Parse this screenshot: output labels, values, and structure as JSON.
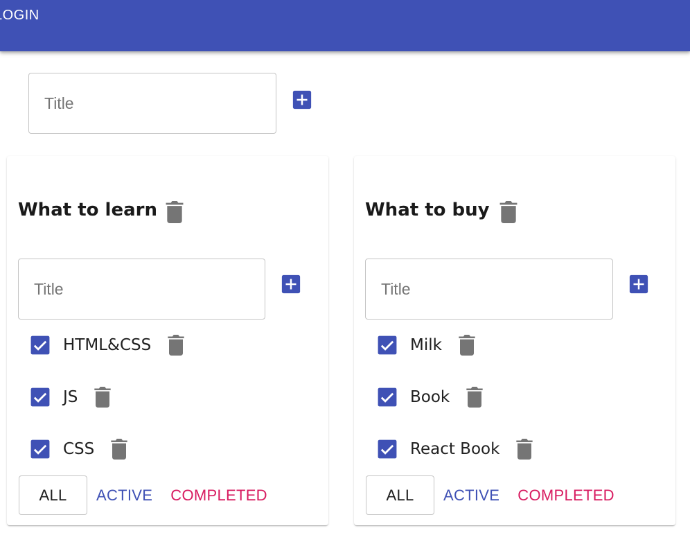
{
  "appbar": {
    "login_label": "LOGIN"
  },
  "add_list": {
    "placeholder": "Title"
  },
  "colors": {
    "primary": "#3f51b5",
    "secondary": "#d81b60",
    "icon_grey": "#757575"
  },
  "lists": [
    {
      "title": "What to learn",
      "input_placeholder": "Title",
      "tasks": [
        {
          "label": "HTML&CSS",
          "checked": true
        },
        {
          "label": "JS",
          "checked": true
        },
        {
          "label": "CSS",
          "checked": true
        }
      ],
      "filters": {
        "all": "ALL",
        "active": "ACTIVE",
        "completed": "COMPLETED"
      }
    },
    {
      "title": "What to buy",
      "input_placeholder": "Title",
      "tasks": [
        {
          "label": "Milk",
          "checked": true
        },
        {
          "label": "Book",
          "checked": true
        },
        {
          "label": "React Book",
          "checked": true
        }
      ],
      "filters": {
        "all": "ALL",
        "active": "ACTIVE",
        "completed": "COMPLETED"
      }
    }
  ]
}
